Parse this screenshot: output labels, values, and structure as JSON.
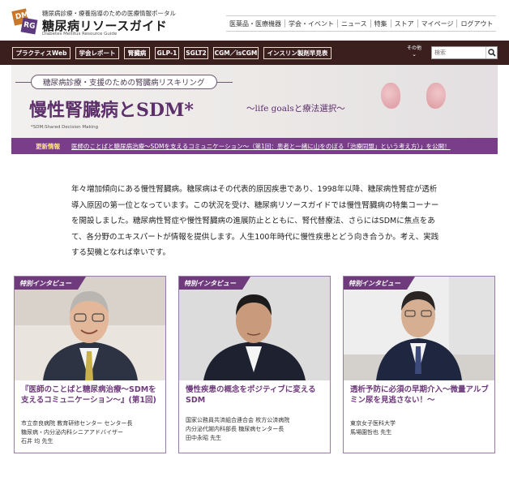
{
  "header": {
    "tagline": "糖尿病診療・療養指導のための医療情報ポータル",
    "site_name": "糖尿病リソースガイド",
    "site_sub": "Diabetes Mellitus Resource Guide",
    "logo_letters": [
      "DM",
      "RG"
    ],
    "nav": [
      "医薬品・医療機器",
      "学会・イベント",
      "ニュース",
      "特集",
      "ストア",
      "マイページ",
      "ログアウト"
    ]
  },
  "categories": {
    "items": [
      "プラクティスWeb",
      "学会レポート",
      "腎臓病",
      "GLP-1",
      "SGLT2",
      "CGM／isCGM",
      "インスリン製剤早見表"
    ],
    "more_label": "その他",
    "search_placeholder": "検索"
  },
  "banner": {
    "pill": "糖尿病診療・支援のための腎臓病リスキリング",
    "title": "慢性腎臓病とSDM*",
    "subtitle": "〜life goalsと療法選択〜",
    "note": "*SDM:Shared Decision Making"
  },
  "update": {
    "label": "更新情報",
    "message": "医師のことばと糖尿病治療〜SDMを支えるコミュニケーション〜（第1回：患者と一緒に山をのぼる「治療同盟」という考え方）」を公開！"
  },
  "intro": {
    "text": "年々増加傾向にある慢性腎臓病。糖尿病はその代表的原因疾患であり、1998年以降、糖尿病性腎症が透析導入原因の第一位となっています。この状況を受け、糖尿病リソースガイドでは慢性腎臓病の特集コーナーを開設しました。糖尿病性腎症や慢性腎臓病の進展防止とともに、腎代替療法、さらにはSDMに焦点をあて、各分野のエキスパートが情報を提供します。人生100年時代に慢性疾患とどう向き合うか。考え、実践する契機となれば幸いです。"
  },
  "cards": [
    {
      "ribbon": "特別インタビュー",
      "title": "『医師のことばと糖尿病治療〜SDMを支えるコミュニケーション〜』(第1回)",
      "meta": "市立奈良病院 教育研修センター センター長\n糖尿病・内分泌内科シニアアドバイザー\n石井 均 先生"
    },
    {
      "ribbon": "特別インタビュー",
      "title": "慢性疾患の概念をポジティブに変えるSDM",
      "meta": "国家公務員共済組合連合会 枚方公済病院\n内分泌代謝内科部長 糖尿病センター長\n田中永昭 先生"
    },
    {
      "ribbon": "特別インタビュー",
      "title": "透析予防に必須の早期介入〜微量アルブミン尿を見逃さない！〜",
      "meta": "東京女子医科大学\n馬場園哲也 先生"
    }
  ],
  "colors": {
    "accent_purple": "#6f3b7d",
    "category_bar": "#3b1e1e",
    "update_bar": "#7a3d8a"
  }
}
